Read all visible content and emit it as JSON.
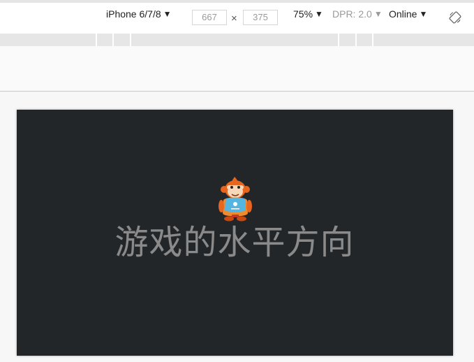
{
  "toolbar": {
    "device": "iPhone 6/7/8",
    "width_value": "667",
    "height_value": "375",
    "times_symbol": "×",
    "zoom": "75%",
    "dpr": "DPR: 2.0",
    "network": "Online",
    "caret": "▼"
  },
  "icons": {
    "rotate": "rotate-icon",
    "mascot": "monkey-mascot-icon"
  },
  "game": {
    "text": "游戏的水平方向",
    "background_color": "#222629",
    "text_color": "#8a8a8a"
  }
}
